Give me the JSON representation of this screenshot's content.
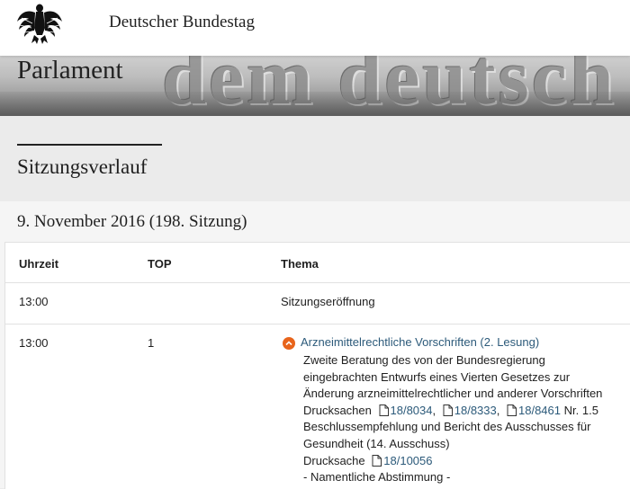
{
  "header": {
    "site_title": "Deutscher Bundestag",
    "logo_icon": "federal-eagle-icon"
  },
  "hero": {
    "title": "Parlament",
    "background_text": "dem deutsch"
  },
  "section": {
    "title": "Sitzungsverlauf"
  },
  "session": {
    "date_title": "9. November 2016 (198. Sitzung)"
  },
  "table": {
    "headers": {
      "time": "Uhrzeit",
      "top": "TOP",
      "topic": "Thema"
    },
    "rows": [
      {
        "time": "13:00",
        "top": "",
        "topic": "Sitzungseröffnung"
      },
      {
        "time": "13:00",
        "top": "1",
        "topic": "Arzneimittelrechtliche Vorschriften (2. Lesung)",
        "topic_icon": "chevron-up-circle-icon",
        "desc_line1": "Zweite Beratung des von der Bundesregierung",
        "desc_line2": "eingebrachten Entwurfs eines Vierten Gesetzes zur",
        "desc_line3": "Änderung arzneimittelrechtlicher und anderer Vorschriften",
        "drucksachen_label": "Drucksachen",
        "drucksachen_links": [
          "18/8034",
          "18/8333",
          "18/8461"
        ],
        "sep": ",",
        "nr_text": "Nr. 1.5",
        "desc_line5": "Beschlussempfehlung und Bericht des Ausschusses für",
        "desc_line6": "Gesundheit (14. Ausschuss)",
        "drucksache_label": "Drucksache",
        "drucksache_link": "18/10056",
        "vote_note": "- Namentliche Abstimmung -",
        "doc_icon": "document-icon"
      }
    ]
  },
  "colors": {
    "link": "#2c5a7a",
    "accent": "#e8641b",
    "page_bg": "#ebebeb"
  }
}
